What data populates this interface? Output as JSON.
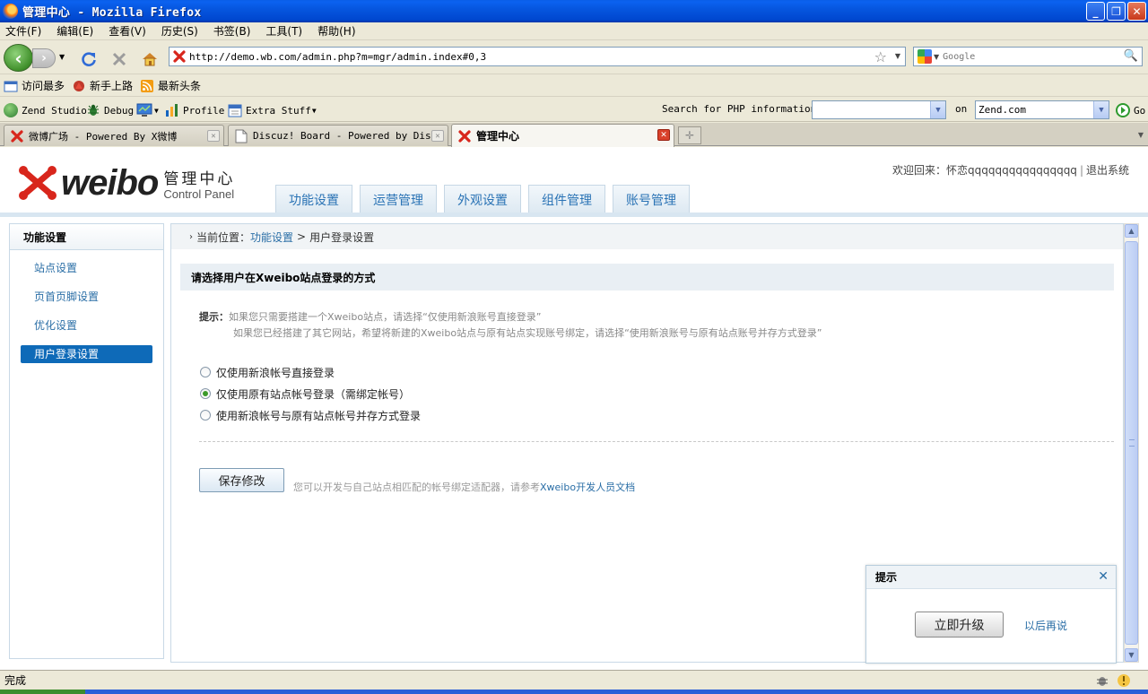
{
  "window": {
    "title": "管理中心 - Mozilla Firefox",
    "controls": [
      "minimize",
      "maximize",
      "close"
    ]
  },
  "menubar": [
    "文件(F)",
    "编辑(E)",
    "查看(V)",
    "历史(S)",
    "书签(B)",
    "工具(T)",
    "帮助(H)"
  ],
  "nav": {
    "url": "http://demo.wb.com/admin.php?m=mgr/admin.index#0,3",
    "search_placeholder": "Google"
  },
  "bookmarks": [
    "访问最多",
    "新手上路",
    "最新头条"
  ],
  "zend": {
    "studio": "Zend Studio",
    "debug": "Debug",
    "profile": "Profile",
    "extra": "Extra Stuff",
    "search_label": "Search for PHP information:",
    "search_value": "",
    "on_label": "on",
    "site_value": "Zend.com",
    "go": "Go"
  },
  "tabs": [
    {
      "label": "微博广场 - Powered By X微博",
      "active": false
    },
    {
      "label": "Discuz! Board - Powered by Disc…",
      "active": false
    },
    {
      "label": "管理中心",
      "active": true
    }
  ],
  "page": {
    "logo": {
      "wordmark": "weibo",
      "cn": "管理中心",
      "en": "Control Panel"
    },
    "welcome": {
      "text": "欢迎回来：怀恋qqqqqqqqqqqqqqqq",
      "sep": "|",
      "logout": "退出系统"
    },
    "top_tabs": [
      "功能设置",
      "运营管理",
      "外观设置",
      "组件管理",
      "账号管理"
    ],
    "sidebar": {
      "title": "功能设置",
      "items": [
        "站点设置",
        "页首页脚设置",
        "优化设置",
        "用户登录设置"
      ],
      "active_index": 3
    },
    "breadcrumb": {
      "prefix": "当前位置：",
      "parent": "功能设置",
      "sep": ">",
      "current": "用户登录设置"
    },
    "section_title": "请选择用户在Xweibo站点登录的方式",
    "tip": {
      "label": "提示：",
      "line1": "如果您只需要搭建一个Xweibo站点，请选择“仅使用新浪账号直接登录”",
      "line2": "如果您已经搭建了其它网站，希望将新建的Xweibo站点与原有站点实现账号绑定，请选择“使用新浪账号与原有站点账号并存方式登录”"
    },
    "options": [
      {
        "label": "仅使用新浪帐号直接登录",
        "checked": false
      },
      {
        "label": "仅使用原有站点帐号登录（需绑定帐号）",
        "checked": true
      },
      {
        "label": "使用新浪帐号与原有站点帐号并存方式登录",
        "checked": false
      }
    ],
    "save_button": "保存修改",
    "save_note": "您可以开发与自己站点相匹配的帐号绑定适配器，请参考",
    "save_link": "Xweibo开发人员文档",
    "popup": {
      "title": "提示",
      "upgrade": "立即升级",
      "later": "以后再说"
    }
  },
  "status": {
    "text": "完成"
  },
  "colors": {
    "accent": "#0e6ab8",
    "link": "#2a6ea6",
    "titlebar": "#0a5ee8"
  }
}
